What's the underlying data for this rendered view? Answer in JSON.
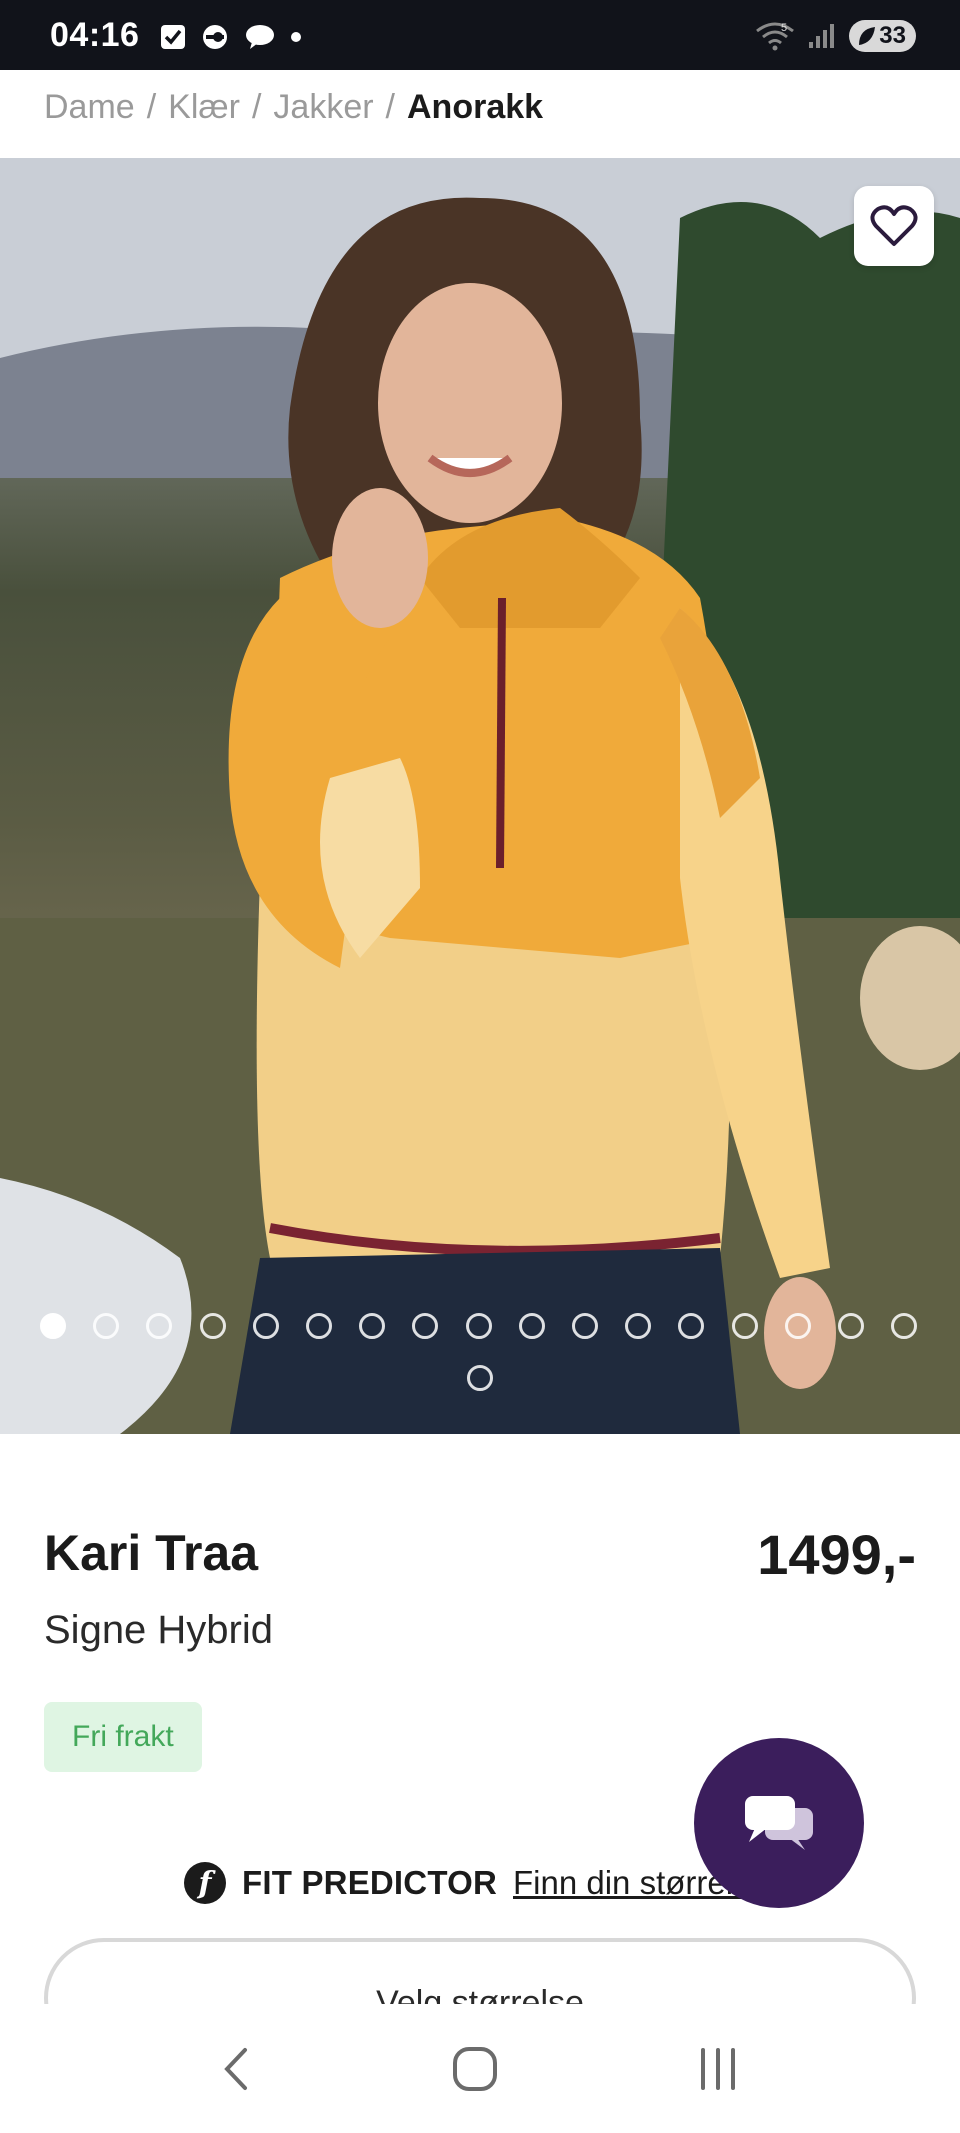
{
  "status_bar": {
    "time": "04:16",
    "battery": "33",
    "signal_label": "5"
  },
  "breadcrumb": {
    "items": [
      "Dame",
      "Klær",
      "Jakker"
    ],
    "separator": "/",
    "current": "Anorakk"
  },
  "gallery": {
    "image_count": 18,
    "active_index": 0
  },
  "product": {
    "brand": "Kari Traa",
    "name": "Signe Hybrid",
    "price": "1499,-",
    "badge": "Fri frakt"
  },
  "fit_predictor": {
    "logo_letter": "f",
    "title": "FIT PREDICTOR",
    "link": "Finn din størrelse"
  },
  "size_selector": {
    "label": "Velg størrelse"
  },
  "colors": {
    "status_bar_bg": "#11131a",
    "chat_fab": "#3b1e5c",
    "badge_bg": "#dff5e3",
    "badge_text": "#43a85a"
  }
}
